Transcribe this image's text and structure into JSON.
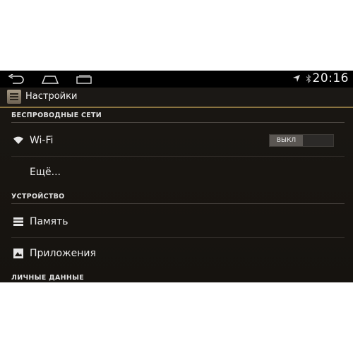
{
  "status_bar": {
    "clock": "20:16",
    "icons": [
      "location-arrow-icon",
      "bluetooth-icon"
    ]
  },
  "nav_bar": {
    "buttons": [
      "back-icon",
      "home-icon",
      "recent-apps-icon"
    ]
  },
  "action_bar": {
    "app_icon": "settings-app-icon",
    "title": "Настройки"
  },
  "sections": {
    "wireless": {
      "title": "БЕСПРОВОДНЫЕ СЕТИ",
      "items": {
        "wifi": {
          "label": "Wi-Fi",
          "icon": "wifi-icon",
          "toggle": "ВЫКЛ"
        },
        "more": {
          "label": "Ещё..."
        }
      }
    },
    "device": {
      "title": "УСТРОЙСТВО",
      "items": {
        "storage": {
          "label": "Память",
          "icon": "storage-icon"
        },
        "apps": {
          "label": "Приложения",
          "icon": "apps-icon"
        }
      }
    },
    "personal": {
      "title": "ЛИЧНЫЕ ДАННЫЕ"
    }
  },
  "colors": {
    "background": "#1a1713",
    "accent_line": "#8a7340",
    "text": "#ececec"
  }
}
